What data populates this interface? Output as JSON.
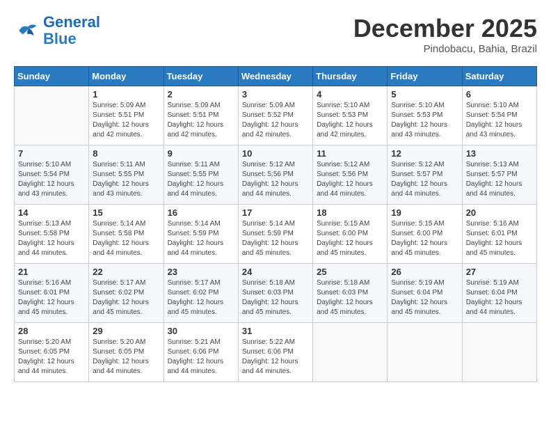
{
  "header": {
    "logo_line1": "General",
    "logo_line2": "Blue",
    "month": "December 2025",
    "location": "Pindobacu, Bahia, Brazil"
  },
  "days_of_week": [
    "Sunday",
    "Monday",
    "Tuesday",
    "Wednesday",
    "Thursday",
    "Friday",
    "Saturday"
  ],
  "weeks": [
    [
      {
        "day": "",
        "info": ""
      },
      {
        "day": "1",
        "info": "Sunrise: 5:09 AM\nSunset: 5:51 PM\nDaylight: 12 hours and 42 minutes."
      },
      {
        "day": "2",
        "info": "Sunrise: 5:09 AM\nSunset: 5:51 PM\nDaylight: 12 hours and 42 minutes."
      },
      {
        "day": "3",
        "info": "Sunrise: 5:09 AM\nSunset: 5:52 PM\nDaylight: 12 hours and 42 minutes."
      },
      {
        "day": "4",
        "info": "Sunrise: 5:10 AM\nSunset: 5:53 PM\nDaylight: 12 hours and 42 minutes."
      },
      {
        "day": "5",
        "info": "Sunrise: 5:10 AM\nSunset: 5:53 PM\nDaylight: 12 hours and 43 minutes."
      },
      {
        "day": "6",
        "info": "Sunrise: 5:10 AM\nSunset: 5:54 PM\nDaylight: 12 hours and 43 minutes."
      }
    ],
    [
      {
        "day": "7",
        "info": "Sunrise: 5:10 AM\nSunset: 5:54 PM\nDaylight: 12 hours and 43 minutes."
      },
      {
        "day": "8",
        "info": "Sunrise: 5:11 AM\nSunset: 5:55 PM\nDaylight: 12 hours and 43 minutes."
      },
      {
        "day": "9",
        "info": "Sunrise: 5:11 AM\nSunset: 5:55 PM\nDaylight: 12 hours and 44 minutes."
      },
      {
        "day": "10",
        "info": "Sunrise: 5:12 AM\nSunset: 5:56 PM\nDaylight: 12 hours and 44 minutes."
      },
      {
        "day": "11",
        "info": "Sunrise: 5:12 AM\nSunset: 5:56 PM\nDaylight: 12 hours and 44 minutes."
      },
      {
        "day": "12",
        "info": "Sunrise: 5:12 AM\nSunset: 5:57 PM\nDaylight: 12 hours and 44 minutes."
      },
      {
        "day": "13",
        "info": "Sunrise: 5:13 AM\nSunset: 5:57 PM\nDaylight: 12 hours and 44 minutes."
      }
    ],
    [
      {
        "day": "14",
        "info": "Sunrise: 5:13 AM\nSunset: 5:58 PM\nDaylight: 12 hours and 44 minutes."
      },
      {
        "day": "15",
        "info": "Sunrise: 5:14 AM\nSunset: 5:58 PM\nDaylight: 12 hours and 44 minutes."
      },
      {
        "day": "16",
        "info": "Sunrise: 5:14 AM\nSunset: 5:59 PM\nDaylight: 12 hours and 44 minutes."
      },
      {
        "day": "17",
        "info": "Sunrise: 5:14 AM\nSunset: 5:59 PM\nDaylight: 12 hours and 45 minutes."
      },
      {
        "day": "18",
        "info": "Sunrise: 5:15 AM\nSunset: 6:00 PM\nDaylight: 12 hours and 45 minutes."
      },
      {
        "day": "19",
        "info": "Sunrise: 5:15 AM\nSunset: 6:00 PM\nDaylight: 12 hours and 45 minutes."
      },
      {
        "day": "20",
        "info": "Sunrise: 5:16 AM\nSunset: 6:01 PM\nDaylight: 12 hours and 45 minutes."
      }
    ],
    [
      {
        "day": "21",
        "info": "Sunrise: 5:16 AM\nSunset: 6:01 PM\nDaylight: 12 hours and 45 minutes."
      },
      {
        "day": "22",
        "info": "Sunrise: 5:17 AM\nSunset: 6:02 PM\nDaylight: 12 hours and 45 minutes."
      },
      {
        "day": "23",
        "info": "Sunrise: 5:17 AM\nSunset: 6:02 PM\nDaylight: 12 hours and 45 minutes."
      },
      {
        "day": "24",
        "info": "Sunrise: 5:18 AM\nSunset: 6:03 PM\nDaylight: 12 hours and 45 minutes."
      },
      {
        "day": "25",
        "info": "Sunrise: 5:18 AM\nSunset: 6:03 PM\nDaylight: 12 hours and 45 minutes."
      },
      {
        "day": "26",
        "info": "Sunrise: 5:19 AM\nSunset: 6:04 PM\nDaylight: 12 hours and 45 minutes."
      },
      {
        "day": "27",
        "info": "Sunrise: 5:19 AM\nSunset: 6:04 PM\nDaylight: 12 hours and 44 minutes."
      }
    ],
    [
      {
        "day": "28",
        "info": "Sunrise: 5:20 AM\nSunset: 6:05 PM\nDaylight: 12 hours and 44 minutes."
      },
      {
        "day": "29",
        "info": "Sunrise: 5:20 AM\nSunset: 6:05 PM\nDaylight: 12 hours and 44 minutes."
      },
      {
        "day": "30",
        "info": "Sunrise: 5:21 AM\nSunset: 6:06 PM\nDaylight: 12 hours and 44 minutes."
      },
      {
        "day": "31",
        "info": "Sunrise: 5:22 AM\nSunset: 6:06 PM\nDaylight: 12 hours and 44 minutes."
      },
      {
        "day": "",
        "info": ""
      },
      {
        "day": "",
        "info": ""
      },
      {
        "day": "",
        "info": ""
      }
    ]
  ]
}
